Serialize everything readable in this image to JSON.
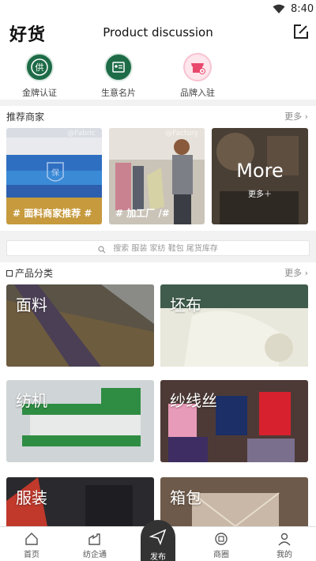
{
  "status_bar": {
    "time": "8:40"
  },
  "header": {
    "brand": "好货",
    "title": "Product discussion"
  },
  "quick_entries": [
    {
      "label": "金牌认证",
      "icon": "gold-certification-icon",
      "badge_text": "供"
    },
    {
      "label": "生意名片",
      "icon": "business-card-icon"
    },
    {
      "label": "品牌入驻",
      "icon": "brand-shop-icon"
    }
  ],
  "recommended": {
    "title": "推荐商家",
    "more": "更多",
    "tiles": [
      {
        "caption": "# 面料商家推荐 #",
        "watermark": "@Fabric",
        "badge_text": "保"
      },
      {
        "caption": "# 加工厂 /#",
        "watermark": "@Factory"
      },
      {
        "caption": "More",
        "sub": "更多＋"
      }
    ]
  },
  "search": {
    "placeholder": "搜索 服装 家纺 鞋包 尾货库存"
  },
  "categories": {
    "title": "产品分类",
    "more": "更多",
    "items": [
      {
        "name": "面料"
      },
      {
        "name": "坯布"
      },
      {
        "name": "纺机"
      },
      {
        "name": "纱线丝"
      },
      {
        "name": "服装"
      },
      {
        "name": "箱包"
      }
    ]
  },
  "bottom_nav": [
    {
      "label": "首页",
      "icon": "home-icon"
    },
    {
      "label": "纺企通",
      "icon": "factory-icon"
    },
    {
      "label": "发布",
      "icon": "send-icon"
    },
    {
      "label": "商圈",
      "icon": "circle-icon"
    },
    {
      "label": "我的",
      "icon": "person-icon"
    }
  ],
  "colors": {
    "brand_green": "#1d6b47",
    "nav_dark": "#333333"
  }
}
